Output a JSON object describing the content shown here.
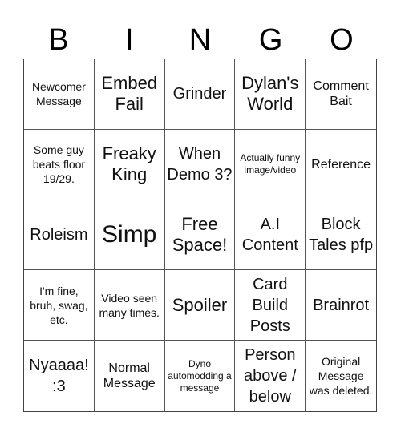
{
  "header": {
    "letters": [
      "B",
      "I",
      "N",
      "G",
      "O"
    ]
  },
  "board": {
    "cells": [
      "Newcomer Message",
      "Embed Fail",
      "Grinder",
      "Dylan's World",
      "Comment Bait",
      "Some guy beats floor 19/29.",
      "Freaky King",
      "When Demo 3?",
      "Actually funny image/video",
      "Reference",
      "Roleism",
      "Simp",
      "Free Space!",
      "A.I Content",
      "Block Tales pfp",
      "I'm fine, bruh, swag, etc.",
      "Video seen many times.",
      "Spoiler",
      "Card Build Posts",
      "Brainrot",
      "Nyaaaa! :3",
      "Normal Message",
      "Dyno automodding a message",
      "Person above / below",
      "Original Message was deleted."
    ]
  }
}
